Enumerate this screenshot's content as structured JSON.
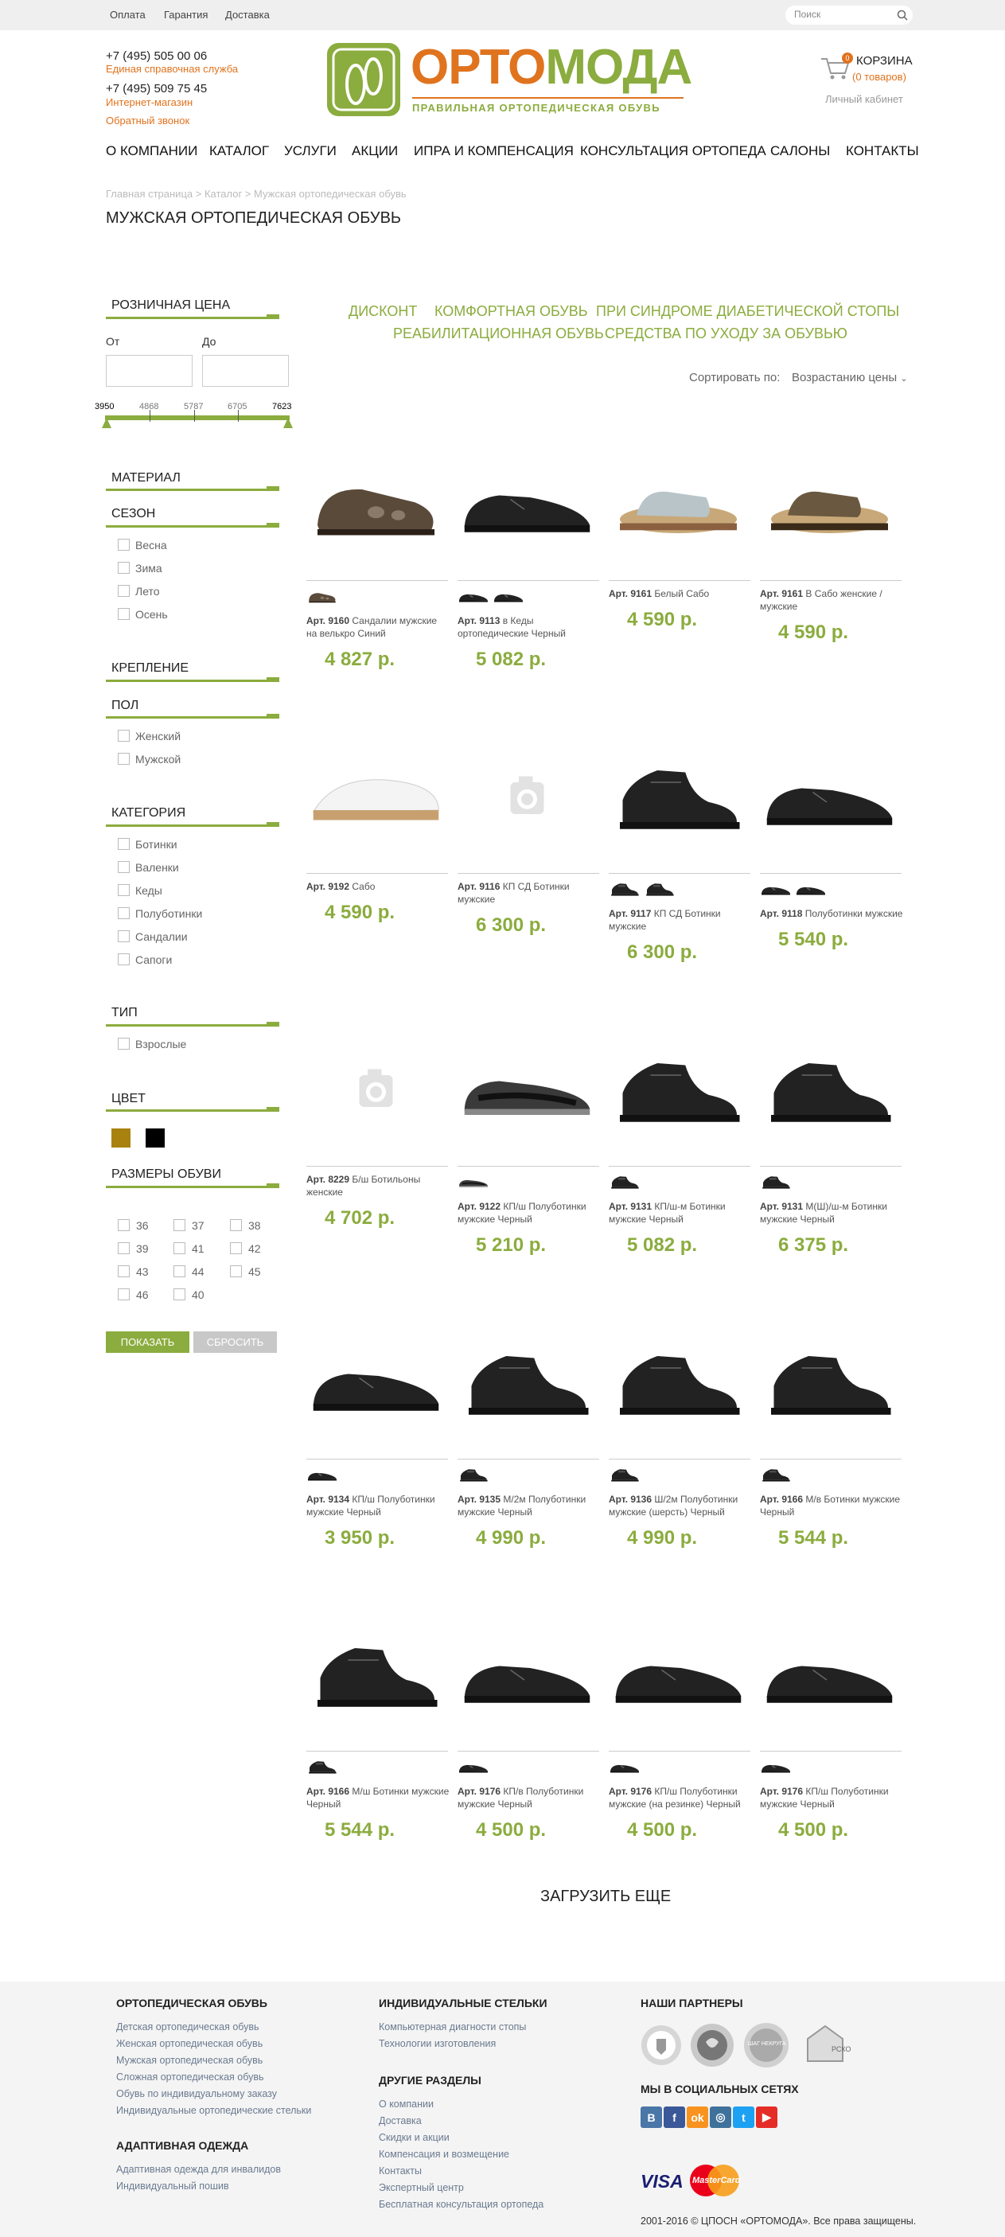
{
  "topbar": {
    "links": [
      "Оплата",
      "Гарантия",
      "Доставка"
    ],
    "search_placeholder": "Поиск"
  },
  "header": {
    "phone1": "+7 (495) 505 00 06",
    "phone1_label": "Единая справочная служба",
    "phone2": "+7 (495) 509 75 45",
    "phone2_label": "Интернет-магазин",
    "callback": "Обратный звонок",
    "logo_orto": "ОРТО",
    "logo_moda": "МОДА",
    "logo_tagline": "ПРАВИЛЬНАЯ ОРТОПЕДИЧЕСКАЯ ОБУВЬ",
    "cart_label": "КОРЗИНА",
    "cart_count": "0",
    "cart_items": "(0 товаров)",
    "account": "Личный кабинет"
  },
  "nav": [
    "О КОМПАНИИ",
    "КАТАЛОГ",
    "УСЛУГИ",
    "АКЦИИ",
    "ИПРА И КОМПЕНСАЦИЯ",
    "КОНСУЛЬТАЦИЯ ОРТОПЕДА",
    "САЛОНЫ",
    "КОНТАКТЫ"
  ],
  "breadcrumb": "Главная страница > Каталог > Мужская ортопедическая обувь",
  "page_title": "МУЖСКАЯ ОРТОПЕДИЧЕСКАЯ ОБУВЬ",
  "filters": {
    "price_title": "РОЗНИЧНАЯ ЦЕНА",
    "from_label": "От",
    "to_label": "До",
    "slider_ticks": [
      "3950",
      "4868",
      "5787",
      "6705",
      "7623"
    ],
    "material_title": "МАТЕРИАЛ",
    "season_title": "СЕЗОН",
    "seasons": [
      "Весна",
      "Зима",
      "Лето",
      "Осень"
    ],
    "fastening_title": "КРЕПЛЕНИЕ",
    "gender_title": "ПОЛ",
    "genders": [
      "Женский",
      "Мужской"
    ],
    "category_title": "КАТЕГОРИЯ",
    "categories": [
      "Ботинки",
      "Валенки",
      "Кеды",
      "Полуботинки",
      "Сандалии",
      "Сапоги"
    ],
    "type_title": "ТИП",
    "types": [
      "Взрослые"
    ],
    "color_title": "ЦВЕТ",
    "colors": [
      "#a8820f",
      "#000000"
    ],
    "sizes_title": "РАЗМЕРЫ ОБУВИ",
    "sizes": [
      "36",
      "37",
      "38",
      "39",
      "41",
      "42",
      "43",
      "44",
      "45",
      "46",
      "40"
    ],
    "show_button": "ПОКАЗАТЬ",
    "reset_button": "СБРОСИТЬ"
  },
  "category_links": [
    "ДИСКОНТ",
    "КОМФОРТНАЯ ОБУВЬ",
    "ПРИ СИНДРОМЕ ДИАБЕТИЧЕСКОЙ СТОПЫ",
    "РЕАБИЛИТАЦИОННАЯ ОБУВЬ",
    "СРЕДСТВА ПО УХОДУ ЗА ОБУВЬЮ"
  ],
  "sort": {
    "label": "Сортировать по:",
    "value": "Возрастанию цены"
  },
  "products": [
    {
      "art": "Арт. 9160",
      "name": "Сандалии мужские на велькро Синий",
      "price": "4 827 р.",
      "icon": "sandal-brown-icon"
    },
    {
      "art": "Арт. 9113",
      "name": "в Кеды ортопедические Черный",
      "price": "5 082 р.",
      "icon": "shoe-black-icon"
    },
    {
      "art": "Арт. 9161",
      "name": "Белый Сабо",
      "price": "4 590 р.",
      "icon": "clog-white-icon"
    },
    {
      "art": "Арт. 9161",
      "name": "В Сабо женские / мужские",
      "price": "4 590 р.",
      "icon": "clog-brown-icon"
    },
    {
      "art": "Арт. 9192",
      "name": "Сабо",
      "price": "4 590 р.",
      "icon": "clog-perforated-icon"
    },
    {
      "art": "Арт. 9116",
      "name": "КП СД Ботинки мужские",
      "price": "6 300 р.",
      "icon": "camera-placeholder-icon"
    },
    {
      "art": "Арт. 9117",
      "name": "КП СД Ботинки мужские",
      "price": "6 300 р.",
      "icon": "boot-black-icon"
    },
    {
      "art": "Арт. 9118",
      "name": "Полуботинки мужские",
      "price": "5 540 р.",
      "icon": "shoe-black-icon"
    },
    {
      "art": "Арт. 8229",
      "name": "Б/ш Ботильоны женские",
      "price": "4 702 р.",
      "icon": "camera-placeholder-icon"
    },
    {
      "art": "Арт. 9122",
      "name": "КП/ш Полуботинки мужские Черный",
      "price": "5 210 р.",
      "icon": "sneaker-black-icon"
    },
    {
      "art": "Арт. 9131",
      "name": "КП/ш-м Ботинки мужские Черный",
      "price": "5 082 р.",
      "icon": "boot-black-icon"
    },
    {
      "art": "Арт. 9131",
      "name": "М(Ш)/ш-м Ботинки мужские Черный",
      "price": "6 375 р.",
      "icon": "boot-black-icon"
    },
    {
      "art": "Арт. 9134",
      "name": "КП/ш Полуботинки мужские Черный",
      "price": "3 950 р.",
      "icon": "shoe-black-icon"
    },
    {
      "art": "Арт. 9135",
      "name": "М/2м Полуботинки мужские Черный",
      "price": "4 990 р.",
      "icon": "boot-black-icon"
    },
    {
      "art": "Арт. 9136",
      "name": "Ш/2м Полуботинки мужские (шерсть) Черный",
      "price": "4 990 р.",
      "icon": "boot-black-icon"
    },
    {
      "art": "Арт. 9166",
      "name": "М/в Ботинки мужские Черный",
      "price": "5 544 р.",
      "icon": "boot-black-icon"
    },
    {
      "art": "Арт. 9166",
      "name": "М/ш Ботинки мужские Черный",
      "price": "5 544 р.",
      "icon": "boot-black-icon"
    },
    {
      "art": "Арт. 9176",
      "name": "КП/в Полуботинки мужские Черный",
      "price": "4 500 р.",
      "icon": "shoe-black-icon"
    },
    {
      "art": "Арт. 9176",
      "name": "КП/ш Полуботинки мужские (на резинке) Черный",
      "price": "4 500 р.",
      "icon": "shoe-black-icon"
    },
    {
      "art": "Арт. 9176",
      "name": "КП/ш Полуботинки мужские Черный",
      "price": "4 500 р.",
      "icon": "shoe-black-icon"
    }
  ],
  "load_more": "ЗАГРУЗИТЬ ЕЩЕ",
  "footer": {
    "col1_title": "ОРТОПЕДИЧЕСКАЯ ОБУВЬ",
    "col1_links": [
      "Детская ортопедическая обувь",
      "Женская ортопедическая обувь",
      "Мужская ортопедическая обувь",
      "Сложная ортопедическая обувь",
      "Обувь по индивидуальному заказу",
      "Индивидуальные ортопедические стельки"
    ],
    "col1b_title": "АДАПТИВНАЯ ОДЕЖДА",
    "col1b_links": [
      "Адаптивная одежда для инвалидов",
      "Индивидуальный пошив"
    ],
    "col2_title": "ИНДИВИДУАЛЬНЫЕ СТЕЛЬКИ",
    "col2_links": [
      "Компьютерная диагности стопы",
      "Технологии изготовления"
    ],
    "col2b_title": "ДРУГИЕ РАЗДЕЛЫ",
    "col2b_links": [
      "О компании",
      "Доставка",
      "Скидки и акции",
      "Компенсация и возмещение",
      "Контакты",
      "Экспертный центр",
      "Бесплатная консультация ортопеда"
    ],
    "partners_title": "НАШИ ПАРТНЕРЫ",
    "partners": [
      "",
      "",
      "ШАГ НЕКРУГА",
      "РСКО"
    ],
    "social_title": "МЫ В СОЦИАЛЬНЫХ СЕТЯХ",
    "social": [
      "В",
      "f",
      "ok",
      "◎",
      "t",
      "▶"
    ],
    "social_colors": [
      "#4a76a8",
      "#3b5998",
      "#f7931e",
      "#3f729b",
      "#1da1f2",
      "#e52d27"
    ],
    "visa": "VISA",
    "mastercard": "MasterCard",
    "copyright": "2001-2016 © ЦПОСН «ОРТОМОДА». Все права защищены."
  }
}
